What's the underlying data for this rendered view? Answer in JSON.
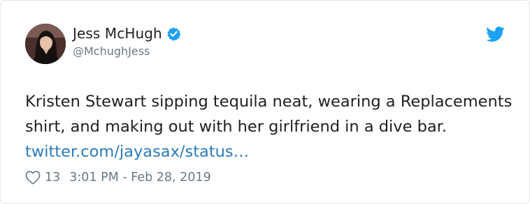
{
  "author": {
    "display_name": "Jess McHugh",
    "handle": "@MchughJess",
    "verified": true
  },
  "tweet": {
    "text": "Kristen Stewart sipping tequila neat, wearing a Replacements shirt, and making out with her girlfriend in a dive bar.",
    "link_text": "twitter.com/jayasax/status…"
  },
  "meta": {
    "like_count": "13",
    "timestamp": "3:01 PM - Feb 28, 2019"
  },
  "icons": {
    "verified": "verified-badge-icon",
    "brand": "twitter-bird-icon",
    "like": "heart-icon"
  },
  "colors": {
    "brand_blue": "#1da1f2",
    "link_blue": "#2b7bb9",
    "text": "#1c2022",
    "muted": "#697882"
  }
}
